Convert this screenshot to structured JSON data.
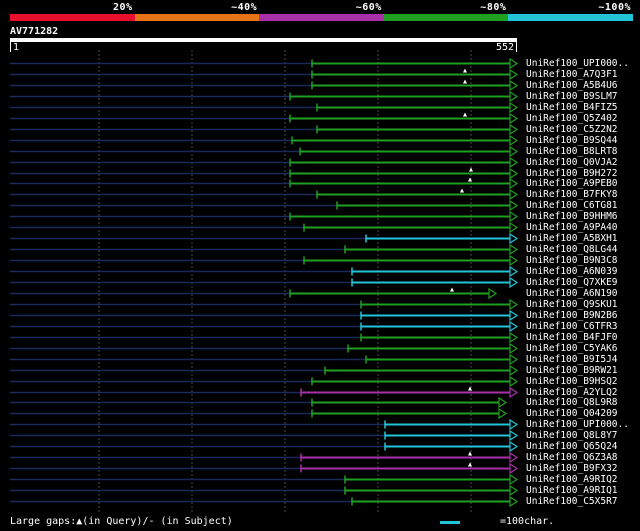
{
  "legend": [
    {
      "label": "20%",
      "color": "#e8102c"
    },
    {
      "label": "~40%",
      "color": "#e87418"
    },
    {
      "label": "~60%",
      "color": "#a830a8"
    },
    {
      "label": "~80%",
      "color": "#20a020"
    },
    {
      "label": "~100%",
      "color": "#22c5d8"
    }
  ],
  "query": {
    "id": "AV771282",
    "start": "1",
    "end": "552"
  },
  "hits": [
    {
      "name": "UniRef100_UPI000..",
      "start": 312,
      "end": 516,
      "color": "green",
      "mark": null,
      "arrow": true
    },
    {
      "name": "UniRef100_A7Q3F1",
      "start": 312,
      "end": 516,
      "color": "green",
      "mark": 465,
      "arrow": true
    },
    {
      "name": "UniRef100_A5B4U6",
      "start": 312,
      "end": 516,
      "color": "green",
      "mark": 465,
      "arrow": true
    },
    {
      "name": "UniRef100_B9SLM7",
      "start": 290,
      "end": 516,
      "color": "green",
      "mark": null,
      "arrow": true
    },
    {
      "name": "UniRef100_B4FIZ5",
      "start": 317,
      "end": 516,
      "color": "green",
      "mark": null,
      "arrow": true
    },
    {
      "name": "UniRef100_Q5Z402",
      "start": 290,
      "end": 516,
      "color": "green",
      "mark": 465,
      "arrow": true
    },
    {
      "name": "UniRef100_C5Z2N2",
      "start": 317,
      "end": 516,
      "color": "green",
      "mark": null,
      "arrow": true
    },
    {
      "name": "UniRef100_B9SQ44",
      "start": 292,
      "end": 516,
      "color": "green",
      "mark": null,
      "arrow": true
    },
    {
      "name": "UniRef100_B8LRT8",
      "start": 300,
      "end": 516,
      "color": "green",
      "mark": null,
      "arrow": true
    },
    {
      "name": "UniRef100_Q0VJA2",
      "start": 290,
      "end": 516,
      "color": "green",
      "mark": null,
      "arrow": true
    },
    {
      "name": "UniRef100_B9H272",
      "start": 290,
      "end": 516,
      "color": "green",
      "mark": 471,
      "arrow": true
    },
    {
      "name": "UniRef100_A9PEB0",
      "start": 290,
      "end": 516,
      "color": "green",
      "mark": 470,
      "arrow": true
    },
    {
      "name": "UniRef100_B7FKY8",
      "start": 317,
      "end": 516,
      "color": "green",
      "mark": 462,
      "arrow": true
    },
    {
      "name": "UniRef100_C6TG81",
      "start": 337,
      "end": 516,
      "color": "green",
      "mark": null,
      "arrow": true
    },
    {
      "name": "UniRef100_B9HHM6",
      "start": 290,
      "end": 516,
      "color": "green",
      "mark": null,
      "arrow": true
    },
    {
      "name": "UniRef100_A9PA40",
      "start": 304,
      "end": 516,
      "color": "green",
      "mark": null,
      "arrow": true
    },
    {
      "name": "UniRef100_A5BXH1",
      "start": 366,
      "end": 516,
      "color": "cyan",
      "mark": null,
      "arrow": true
    },
    {
      "name": "UniRef100_Q8LG44",
      "start": 345,
      "end": 516,
      "color": "green",
      "mark": null,
      "arrow": true
    },
    {
      "name": "UniRef100_B9N3C8",
      "start": 304,
      "end": 516,
      "color": "green",
      "mark": null,
      "arrow": true
    },
    {
      "name": "UniRef100_A6N039",
      "start": 352,
      "end": 516,
      "color": "cyan",
      "mark": null,
      "arrow": true
    },
    {
      "name": "UniRef100_Q7XKE9",
      "start": 352,
      "end": 516,
      "color": "cyan",
      "mark": null,
      "arrow": true
    },
    {
      "name": "UniRef100_A6N190",
      "start": 290,
      "end": 495,
      "color": "green",
      "mark": 452,
      "arrow": true
    },
    {
      "name": "UniRef100_Q9SKU1",
      "start": 361,
      "end": 516,
      "color": "green",
      "mark": null,
      "arrow": true
    },
    {
      "name": "UniRef100_B9N2B6",
      "start": 361,
      "end": 516,
      "color": "cyan",
      "mark": null,
      "arrow": true
    },
    {
      "name": "UniRef100_C6TFR3",
      "start": 361,
      "end": 516,
      "color": "cyan",
      "mark": null,
      "arrow": true
    },
    {
      "name": "UniRef100_B4FJF0",
      "start": 361,
      "end": 516,
      "color": "green",
      "mark": null,
      "arrow": true
    },
    {
      "name": "UniRef100_C5YAK6",
      "start": 348,
      "end": 516,
      "color": "green",
      "mark": null,
      "arrow": true
    },
    {
      "name": "UniRef100_B9I5J4",
      "start": 366,
      "end": 516,
      "color": "green",
      "mark": null,
      "arrow": true
    },
    {
      "name": "UniRef100_B9RW21",
      "start": 325,
      "end": 516,
      "color": "green",
      "mark": null,
      "arrow": true
    },
    {
      "name": "UniRef100_B9HSQ2",
      "start": 312,
      "end": 516,
      "color": "green",
      "mark": null,
      "arrow": true
    },
    {
      "name": "UniRef100_A2YLQ2",
      "start": 301,
      "end": 516,
      "color": "purple",
      "mark": 470,
      "arrow": true
    },
    {
      "name": "UniRef100_Q8L9R8",
      "start": 312,
      "end": 505,
      "color": "green",
      "mark": null,
      "arrow": true
    },
    {
      "name": "UniRef100_Q04209",
      "start": 312,
      "end": 505,
      "color": "green",
      "mark": null,
      "arrow": true
    },
    {
      "name": "UniRef100_UPI000..",
      "start": 385,
      "end": 516,
      "color": "cyan",
      "mark": null,
      "arrow": true
    },
    {
      "name": "UniRef100_Q8L8Y7",
      "start": 385,
      "end": 516,
      "color": "cyan",
      "mark": null,
      "arrow": true
    },
    {
      "name": "UniRef100_Q65Q24",
      "start": 385,
      "end": 516,
      "color": "cyan",
      "mark": null,
      "arrow": true
    },
    {
      "name": "UniRef100_Q6Z3A8",
      "start": 301,
      "end": 516,
      "color": "purple",
      "mark": 470,
      "arrow": true
    },
    {
      "name": "UniRef100_B9FX32",
      "start": 301,
      "end": 516,
      "color": "purple",
      "mark": 470,
      "arrow": true
    },
    {
      "name": "UniRef100_A9RIQ2",
      "start": 345,
      "end": 516,
      "color": "green",
      "mark": null,
      "arrow": true
    },
    {
      "name": "UniRef100_A9RIQ1",
      "start": 345,
      "end": 516,
      "color": "green",
      "mark": null,
      "arrow": true
    },
    {
      "name": "UniRef100_C5X5R7",
      "start": 352,
      "end": 516,
      "color": "green",
      "mark": null,
      "arrow": true
    }
  ],
  "colors": {
    "green": "#20a020",
    "cyan": "#22c5d8",
    "purple": "#a830a8",
    "unaligned": "#1a2a5a",
    "grid": "#4a4a4a"
  },
  "footer": {
    "gaps_text": "Large gaps:▲(in Query)/- (in Subject)",
    "scale_text": "=100char."
  }
}
